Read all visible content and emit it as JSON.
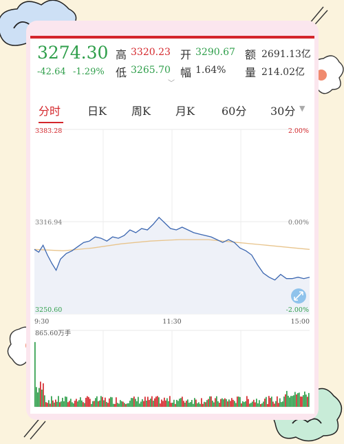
{
  "quote": {
    "price": "3274.30",
    "change": "-42.64",
    "change_pct": "-1.29%",
    "high_label": "高",
    "high_value": "3320.23",
    "open_label": "开",
    "open_value": "3290.67",
    "amount_label": "额",
    "amount_value": "2691.13亿",
    "low_label": "低",
    "low_value": "3265.70",
    "amplitude_label": "幅",
    "amplitude_value": "1.64%",
    "volume_label": "量",
    "volume_value": "214.02亿"
  },
  "tabs": [
    {
      "label": "分时",
      "active": true
    },
    {
      "label": "日K",
      "active": false
    },
    {
      "label": "周K",
      "active": false
    },
    {
      "label": "月K",
      "active": false
    },
    {
      "label": "60分",
      "active": false
    },
    {
      "label": "30分",
      "active": false
    }
  ],
  "chart_data": {
    "type": "line",
    "y_left_ticks": [
      "3383.28",
      "3316.94",
      "3250.60"
    ],
    "y_right_ticks": [
      "2.00%",
      "0.00%",
      "-2.00%"
    ],
    "ylim": [
      3250.6,
      3383.28
    ],
    "x_ticks": [
      "9:30",
      "11:30",
      "15:00"
    ],
    "volume_max_label": "865.60万手",
    "series": [
      {
        "color": "#3b66b0",
        "points": [
          [
            0,
            3297
          ],
          [
            3,
            3295
          ],
          [
            6,
            3300
          ],
          [
            9,
            3293
          ],
          [
            12,
            3287
          ],
          [
            15,
            3282
          ],
          [
            18,
            3290
          ],
          [
            22,
            3294
          ],
          [
            26,
            3296
          ],
          [
            30,
            3299
          ],
          [
            34,
            3302
          ],
          [
            38,
            3303
          ],
          [
            42,
            3306
          ],
          [
            46,
            3305
          ],
          [
            50,
            3303
          ],
          [
            54,
            3306
          ],
          [
            58,
            3305
          ],
          [
            62,
            3307
          ],
          [
            66,
            3311
          ],
          [
            70,
            3309
          ],
          [
            74,
            3312
          ],
          [
            78,
            3311
          ],
          [
            82,
            3315
          ],
          [
            86,
            3320
          ],
          [
            90,
            3316
          ],
          [
            94,
            3312
          ],
          [
            98,
            3311
          ],
          [
            102,
            3313
          ],
          [
            106,
            3311
          ],
          [
            110,
            3309
          ],
          [
            114,
            3308
          ],
          [
            118,
            3307
          ],
          [
            122,
            3306
          ],
          [
            126,
            3304
          ],
          [
            130,
            3302
          ],
          [
            134,
            3304
          ],
          [
            138,
            3302
          ],
          [
            142,
            3298
          ],
          [
            146,
            3296
          ],
          [
            150,
            3293
          ],
          [
            154,
            3286
          ],
          [
            158,
            3280
          ],
          [
            162,
            3277
          ],
          [
            166,
            3275
          ],
          [
            170,
            3279
          ],
          [
            174,
            3276
          ],
          [
            178,
            3276
          ],
          [
            182,
            3277
          ],
          [
            186,
            3276
          ],
          [
            190,
            3277
          ]
        ]
      },
      {
        "color": "#e8c48c",
        "points": [
          [
            0,
            3297
          ],
          [
            20,
            3296
          ],
          [
            40,
            3298
          ],
          [
            60,
            3301
          ],
          [
            80,
            3303
          ],
          [
            100,
            3304
          ],
          [
            120,
            3304
          ],
          [
            140,
            3302
          ],
          [
            160,
            3300
          ],
          [
            180,
            3298
          ],
          [
            190,
            3297
          ]
        ]
      }
    ],
    "volume": [
      {
        "n": 14,
        "dir": 1
      }
    ]
  }
}
